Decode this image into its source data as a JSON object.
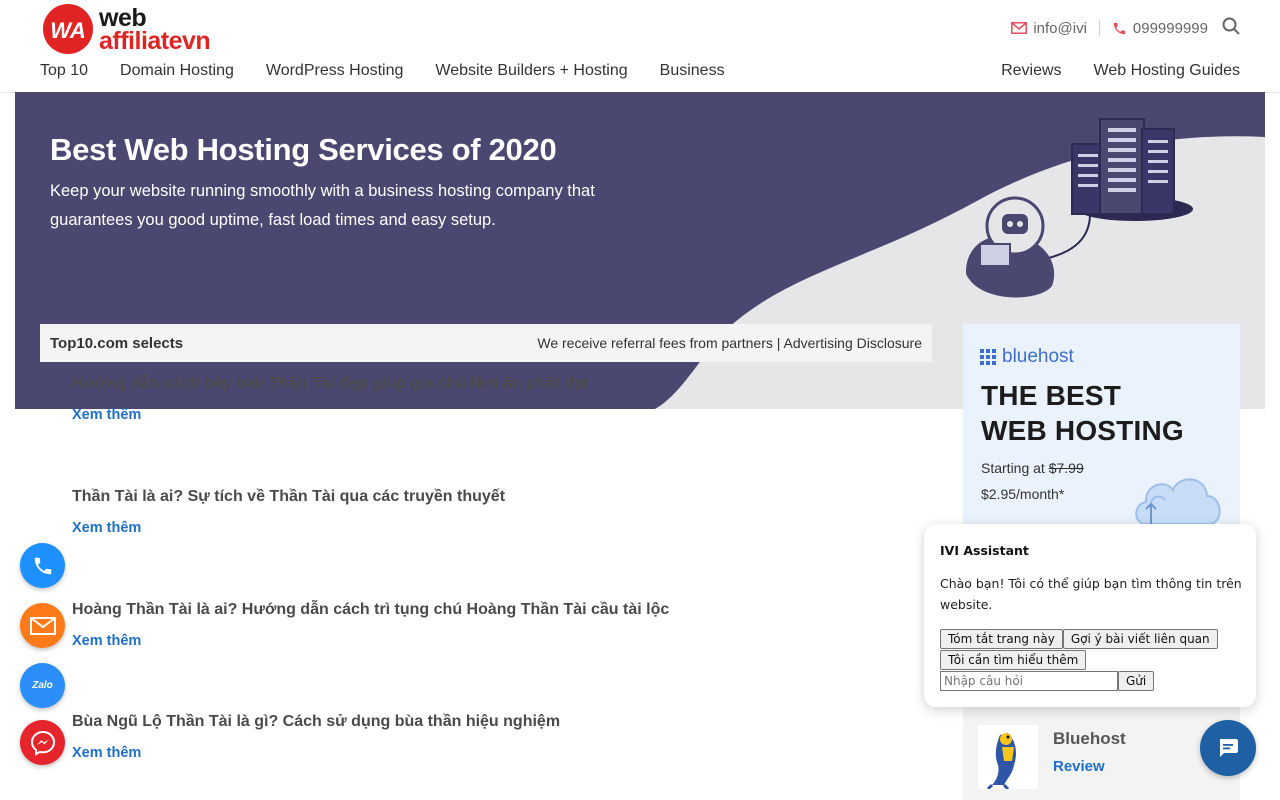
{
  "header": {
    "logo": {
      "line1": "web",
      "line2": "affiliatevn",
      "mark_letters": "WA",
      "accent_color": "#e02424"
    },
    "contact": {
      "email": "info@ivi",
      "phone": "099999999"
    },
    "nav_left": [
      "Top 10",
      "Domain Hosting",
      "WordPress Hosting",
      "Website Builders + Hosting",
      "Business"
    ],
    "nav_right": [
      "Reviews",
      "Web Hosting Guides"
    ]
  },
  "hero": {
    "title": "Best Web Hosting Services of 2020",
    "subtitle": "Keep your website running smoothly with a business hosting company that guarantees you good uptime, fast load times and easy setup.",
    "bg_color": "#4a4771"
  },
  "selection_bar": {
    "left": "Top10.com selects",
    "right": "We receive referral fees from partners | Advertising Disclosure"
  },
  "articles": [
    {
      "title": "Hướng dẫn cách bày ban Thần Tài đẹp giúp gia chủ làm ăn phát đạt",
      "more": "Xem thêm"
    },
    {
      "title": "Thần Tài là ai? Sự tích về Thần Tài qua các truyền thuyết",
      "more": "Xem thêm"
    },
    {
      "title": "Hoàng Thần Tài là ai? Hướng dẫn cách trì tụng chú Hoàng Thần Tài cầu tài lộc",
      "more": "Xem thêm"
    },
    {
      "title": "Bùa Ngũ Lộ Thần Tài là gì? Cách sử dụng bùa thần hiệu nghiệm",
      "more": "Xem thêm"
    }
  ],
  "ad": {
    "brand": "bluehost",
    "headline_1": "THE BEST",
    "headline_2": "WEB HOSTING",
    "starting_at": "Starting at",
    "old_price": "$7.99",
    "new_price": "$2.95/month*",
    "brand_color": "#3c6fd1"
  },
  "review_card": {
    "name": "Bluehost",
    "link": "Review"
  },
  "assistant": {
    "title": "IVI Assistant",
    "message": "Chào bạn! Tôi có thể giúp bạn tìm thông tin trên website.",
    "buttons": [
      "Tóm tắt trang này",
      "Gợi ý bài viết liên quan",
      "Tôi cần tìm hiểu thêm"
    ],
    "input_placeholder": "Nhập câu hỏi",
    "send_label": "Gửi"
  },
  "floating_buttons": {
    "zalo_label": "Zalo",
    "colors": {
      "phone": "#1e90ff",
      "mail": "#ff7b1a",
      "zalo": "#2c8ef8",
      "messenger": "#e5242b",
      "chat": "#1f5fa3"
    }
  }
}
